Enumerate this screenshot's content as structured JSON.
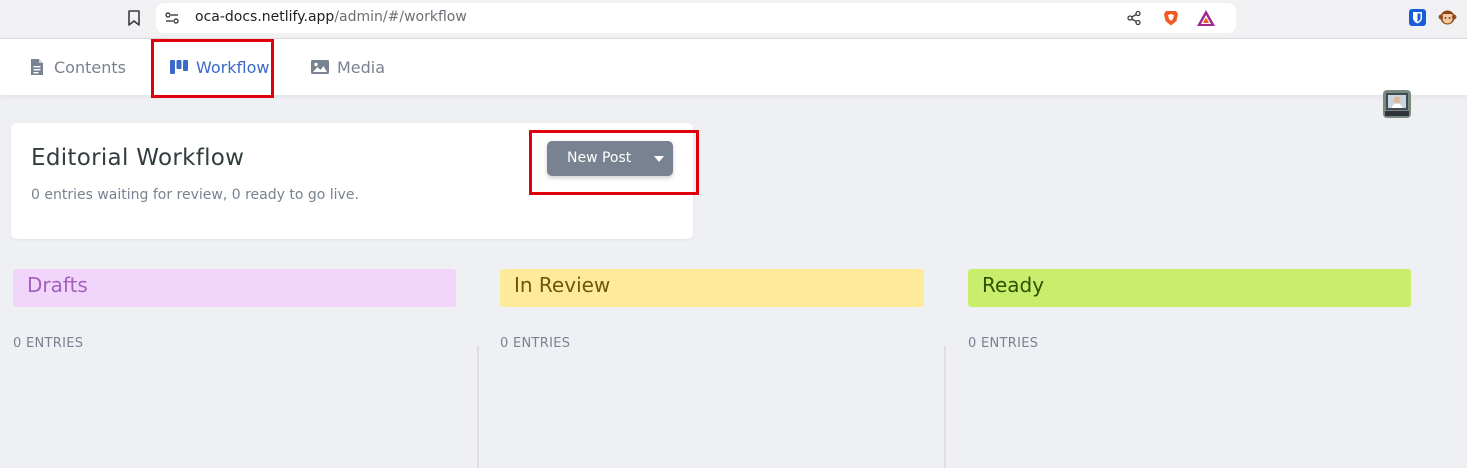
{
  "browser": {
    "url_host": "oca-docs.netlify.app",
    "url_path": "/admin/#/workflow"
  },
  "nav": {
    "items": [
      {
        "label": "Contents",
        "icon": "document-icon",
        "active": false
      },
      {
        "label": "Workflow",
        "icon": "workflow-icon",
        "active": true
      },
      {
        "label": "Media",
        "icon": "image-icon",
        "active": false
      }
    ]
  },
  "workflow": {
    "title": "Editorial Workflow",
    "description": "0 entries waiting for review, 0 ready to go live.",
    "new_post_label": "New Post"
  },
  "columns": [
    {
      "title": "Drafts",
      "count_label": "0 ENTRIES",
      "color": "#f2d5fb",
      "text_color": "#a360bc"
    },
    {
      "title": "In Review",
      "count_label": "0 ENTRIES",
      "color": "#fdeb9a",
      "text_color": "#6f5508"
    },
    {
      "title": "Ready",
      "count_label": "0 ENTRIES",
      "color": "#c9ed6d",
      "text_color": "#2d5200"
    }
  ],
  "colors": {
    "accent": "#3a69c7",
    "highlight": "#e0000b",
    "button": "#798291"
  }
}
